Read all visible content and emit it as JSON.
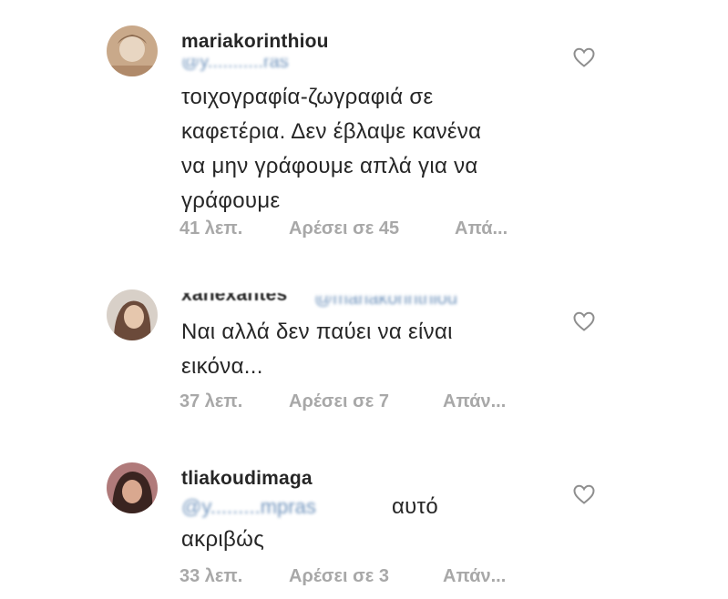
{
  "comments": [
    {
      "username": "mariakorinthiou",
      "mention": "@y...........ras",
      "text": "τοιχογραφία-ζωγραφιά  σε\nκαφετέρια. Δεν έβλαψε κανένα\nνα μην γράφουμε απλά για να\nγράφουμε",
      "time": "41 λεπ.",
      "likes": "Αρέσει σε 45",
      "reply": "Απά...",
      "avatar_icon": "profile-photo-icon",
      "heart_icon": "heart-outline-icon"
    },
    {
      "username": "xanexantes",
      "mention": "@mariakorinthiou",
      "text": "Ναι αλλά δεν παύει να είναι\nεικόνα...",
      "time": "37 λεπ.",
      "likes": "Αρέσει σε 7",
      "reply": "Απάν...",
      "avatar_icon": "profile-photo-icon",
      "heart_icon": "heart-outline-icon"
    },
    {
      "username": "tliakoudimaga",
      "mention": "@y.........mpras",
      "text_after_mention": "αυτό",
      "text": "ακριβώς",
      "time": "33 λεπ.",
      "likes": "Αρέσει σε 3",
      "reply": "Απάν...",
      "avatar_icon": "profile-photo-icon",
      "heart_icon": "heart-outline-icon"
    }
  ],
  "colors": {
    "text": "#262626",
    "meta": "#a8a8a8",
    "mention": "#3f6fa6",
    "heart": "#8e8e8e"
  }
}
